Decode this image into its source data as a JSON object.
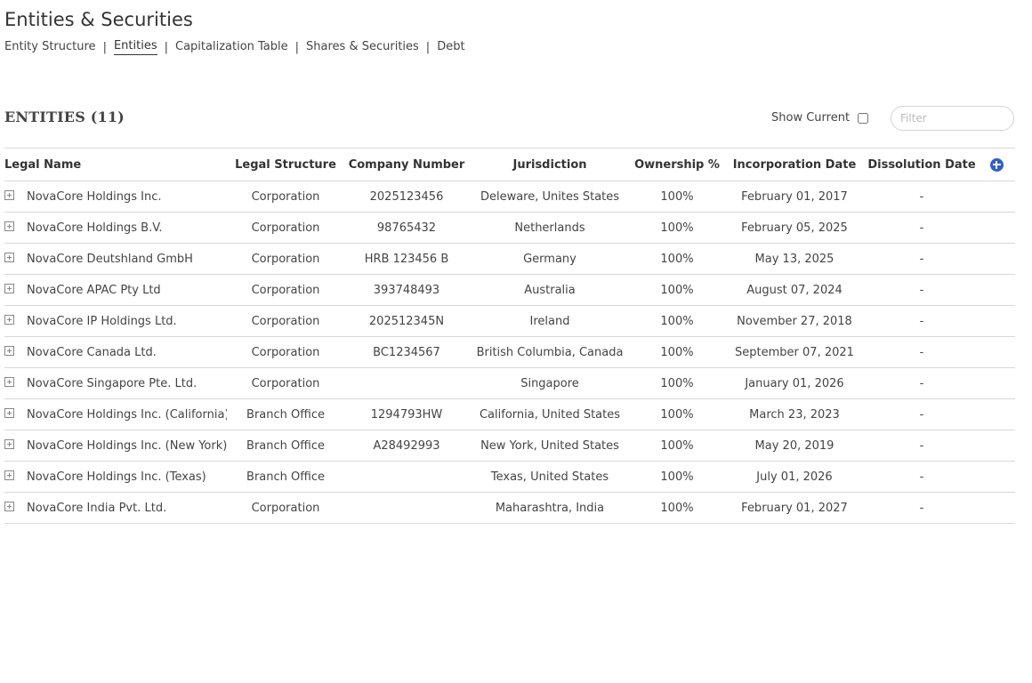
{
  "page": {
    "title": "Entities & Securities"
  },
  "subnav": [
    {
      "label": "Entity Structure",
      "active": false
    },
    {
      "label": "Entities",
      "active": true
    },
    {
      "label": "Capitalization Table",
      "active": false
    },
    {
      "label": "Shares & Securities",
      "active": false
    },
    {
      "label": "Debt",
      "active": false
    }
  ],
  "section": {
    "title": "ENTITIES (11)",
    "show_current_label": "Show Current",
    "show_current_checked": false,
    "filter_placeholder": "Filter"
  },
  "table": {
    "columns": [
      "Legal Name",
      "Legal Structure",
      "Company Number",
      "Jurisdiction",
      "Ownership %",
      "Incorporation Date",
      "Dissolution Date"
    ],
    "rows": [
      {
        "name": "NovaCore Holdings Inc.",
        "structure": "Corporation",
        "number": "2025123456",
        "jurisdiction": "Deleware, Unites States",
        "ownership": "100%",
        "incorporation": "February 01, 2017",
        "dissolution": "-"
      },
      {
        "name": "NovaCore Holdings B.V.",
        "structure": "Corporation",
        "number": "98765432",
        "jurisdiction": "Netherlands",
        "ownership": "100%",
        "incorporation": "February 05, 2025",
        "dissolution": "-"
      },
      {
        "name": "NovaCore Deutshland GmbH",
        "structure": "Corporation",
        "number": "HRB 123456 B",
        "jurisdiction": "Germany",
        "ownership": "100%",
        "incorporation": "May 13, 2025",
        "dissolution": "-"
      },
      {
        "name": "NovaCore APAC Pty Ltd",
        "structure": "Corporation",
        "number": "393748493",
        "jurisdiction": "Australia",
        "ownership": "100%",
        "incorporation": "August 07, 2024",
        "dissolution": "-"
      },
      {
        "name": "NovaCore IP Holdings Ltd.",
        "structure": "Corporation",
        "number": "202512345N",
        "jurisdiction": "Ireland",
        "ownership": "100%",
        "incorporation": "November 27, 2018",
        "dissolution": "-"
      },
      {
        "name": "NovaCore Canada Ltd.",
        "structure": "Corporation",
        "number": "BC1234567",
        "jurisdiction": "British Columbia, Canada",
        "ownership": "100%",
        "incorporation": "September 07, 2021",
        "dissolution": "-"
      },
      {
        "name": "NovaCore Singapore Pte. Ltd.",
        "structure": "Corporation",
        "number": "",
        "jurisdiction": "Singapore",
        "ownership": "100%",
        "incorporation": "January 01, 2026",
        "dissolution": "-"
      },
      {
        "name": "NovaCore Holdings Inc. (California)",
        "structure": "Branch Office",
        "number": "1294793HW",
        "jurisdiction": "California, United States",
        "ownership": "100%",
        "incorporation": "March 23, 2023",
        "dissolution": "-"
      },
      {
        "name": "NovaCore Holdings Inc. (New York)",
        "structure": "Branch Office",
        "number": "A28492993",
        "jurisdiction": "New York, United States",
        "ownership": "100%",
        "incorporation": "May 20, 2019",
        "dissolution": "-"
      },
      {
        "name": "NovaCore Holdings Inc. (Texas)",
        "structure": "Branch Office",
        "number": "",
        "jurisdiction": "Texas, United States",
        "ownership": "100%",
        "incorporation": "July 01, 2026",
        "dissolution": "-"
      },
      {
        "name": "NovaCore India Pvt. Ltd.",
        "structure": "Corporation",
        "number": "",
        "jurisdiction": "Maharashtra, India",
        "ownership": "100%",
        "incorporation": "February 01, 2027",
        "dissolution": "-"
      }
    ]
  },
  "icons": {
    "expand": "expand-plus-icon",
    "add": "add-circle-icon"
  },
  "colors": {
    "accent": "#2f5dc9",
    "border": "#d8d8d8",
    "text": "#333333"
  }
}
